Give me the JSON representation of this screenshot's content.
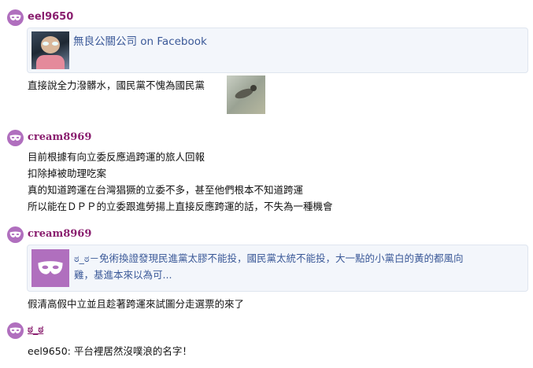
{
  "posts": [
    {
      "author": "eel9650",
      "card": {
        "title": "無良公關公司",
        "suffix": "on Facebook"
      },
      "lines": [
        "直接說全力潑髒水，國民黨不愧為國民黨"
      ]
    },
    {
      "author": "cream8969",
      "lines": [
        "目前根據有向立委反應過跨運的旅人回報",
        "扣除掉被助理吃案",
        "真的知道跨運在台灣猖獗的立委不多，甚至他們根本不知道跨運",
        "所以能在ＤＰＰ的立委跟進勞揚上直接反應跨運的話，不失為一種機會"
      ]
    },
    {
      "author": "cream8969",
      "card": {
        "line1": "ಠ_ಠ－免術換證發現民進黨太膠不能投，國民黨太統不能投，大一點的小黨白的黃的都風向",
        "line2": "雞，基進本來以為可..."
      },
      "lines": [
        "假清高假中立並且趁著跨運來試圖分走選票的來了"
      ]
    },
    {
      "author": "ಠ_ಠ",
      "lines": [
        "eel9650: 平台裡居然沒噗浪的名字！"
      ]
    }
  ],
  "colors": {
    "author": "#8a1f6f",
    "avatar": "#b06fbe",
    "link": "#3b5998"
  },
  "icons": [
    "mask-icon",
    "profile-photo",
    "bird-thumbnail"
  ]
}
